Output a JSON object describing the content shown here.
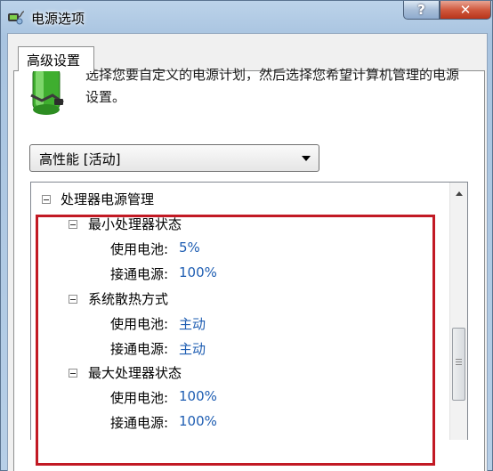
{
  "window": {
    "title": "电源选项",
    "help_label": "?",
    "close_label": "✕"
  },
  "tab": {
    "label": "高级设置"
  },
  "description": "选择您要自定义的电源计划，然后选择您希望计算机管理的电源设置。",
  "plan_select": {
    "value": "高性能 [活动]"
  },
  "tree": {
    "root": "处理器电源管理",
    "groups": [
      {
        "label": "最小处理器状态",
        "battery_label": "使用电池:",
        "battery_value": "5%",
        "plugged_label": "接通电源:",
        "plugged_value": "100%"
      },
      {
        "label": "系统散热方式",
        "battery_label": "使用电池:",
        "battery_value": "主动",
        "plugged_label": "接通电源:",
        "plugged_value": "主动"
      },
      {
        "label": "最大处理器状态",
        "battery_label": "使用电池:",
        "battery_value": "100%",
        "plugged_label": "接通电源:",
        "plugged_value": "100%"
      }
    ]
  },
  "colors": {
    "highlight": "#c21a24",
    "value_text": "#1e5db2",
    "close_red": "#d05a3f"
  },
  "icons": [
    "power-plug-icon",
    "battery-icon",
    "help-icon",
    "close-icon",
    "dropdown-arrow-icon",
    "collapse-icon",
    "scroll-up-icon"
  ]
}
